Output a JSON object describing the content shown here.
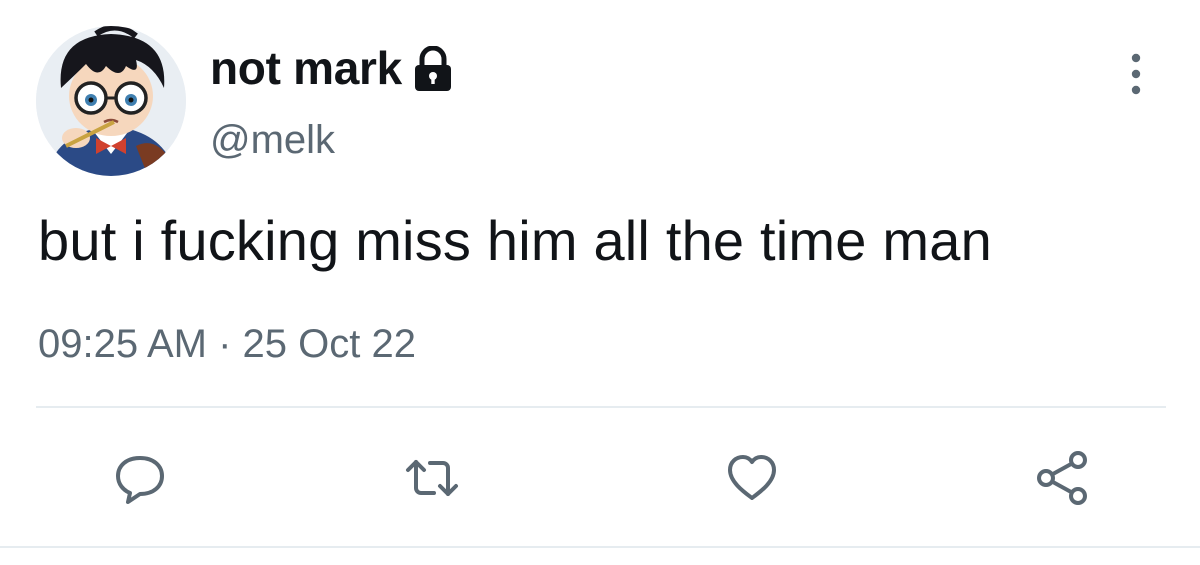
{
  "tweet": {
    "display_name": "not mark",
    "handle": "@melk",
    "protected_icon": "lock-icon",
    "text": "but i fucking miss him all the time man",
    "timestamp": "09:25 AM · 25 Oct 22",
    "menu_icon": "more-vertical-icon"
  },
  "actions": [
    {
      "name": "reply",
      "icon": "reply-icon"
    },
    {
      "name": "retweet",
      "icon": "retweet-icon"
    },
    {
      "name": "like",
      "icon": "heart-icon"
    },
    {
      "name": "share",
      "icon": "share-icon"
    }
  ],
  "colors": {
    "text_primary": "#111418",
    "text_secondary": "#5b6873",
    "icon": "#5b6873",
    "divider": "#e6ecf0"
  }
}
